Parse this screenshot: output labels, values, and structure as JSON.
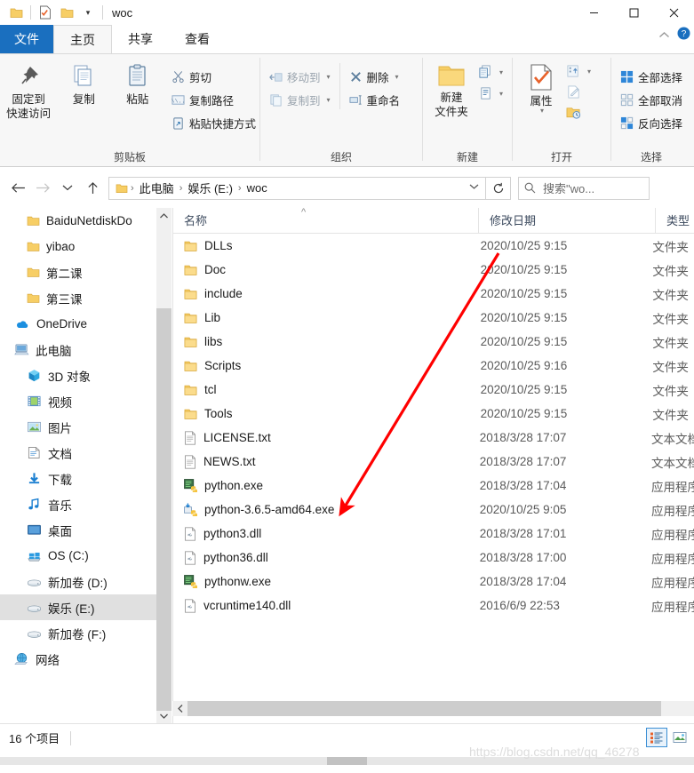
{
  "window": {
    "title": "woc",
    "quick_access": [
      "folder-icon",
      "properties-icon",
      "new-folder-icon"
    ],
    "qat_dropdown": "▾",
    "minimize": "—",
    "maximize": "▢",
    "close": "✕"
  },
  "tabs": [
    {
      "id": "file",
      "label": "文件"
    },
    {
      "id": "home",
      "label": "主页"
    },
    {
      "id": "share",
      "label": "共享"
    },
    {
      "id": "view",
      "label": "查看"
    }
  ],
  "ribbon": {
    "collapse_icon": "chevron-up-icon",
    "help_icon": "help-icon",
    "groups": [
      {
        "id": "clipboard",
        "label": "剪贴板",
        "big_buttons": [
          {
            "id": "pin-to-quick-access",
            "label": "固定到\n快速访问",
            "line1": "固定到",
            "line2": "快速访问",
            "icon": "pin-icon"
          },
          {
            "id": "copy",
            "label": "复制",
            "icon": "copy-icon"
          },
          {
            "id": "paste",
            "label": "粘贴",
            "icon": "paste-icon"
          }
        ],
        "small_buttons": [
          {
            "id": "cut",
            "label": "剪切",
            "icon": "scissors-icon",
            "dim": false
          },
          {
            "id": "copy-path",
            "label": "复制路径",
            "icon": "copy-path-icon",
            "dim": false
          },
          {
            "id": "paste-shortcut",
            "label": "粘贴快捷方式",
            "icon": "paste-shortcut-icon",
            "dim": false
          }
        ]
      },
      {
        "id": "organize",
        "label": "组织",
        "small_buttons": [
          {
            "id": "move-to",
            "label": "移动到",
            "icon": "move-to-icon",
            "caret": "▾",
            "dim": true
          },
          {
            "id": "copy-to",
            "label": "复制到",
            "icon": "copy-to-icon",
            "caret": "▾",
            "dim": true
          },
          {
            "id": "delete",
            "label": "删除",
            "icon": "delete-x-icon",
            "caret": "▾",
            "dim": false
          },
          {
            "id": "rename",
            "label": "重命名",
            "icon": "rename-icon",
            "dim": false
          }
        ]
      },
      {
        "id": "new",
        "label": "新建",
        "big_buttons": [
          {
            "id": "new-folder",
            "label": "新建\n文件夹",
            "line1": "新建",
            "line2": "文件夹",
            "icon": "new-folder-icon"
          }
        ],
        "stack_icons": [
          {
            "id": "new-item",
            "icon": "new-item-icon",
            "caret": "▾"
          },
          {
            "id": "easy-access",
            "icon": "easy-access-icon",
            "caret": "▾"
          }
        ]
      },
      {
        "id": "open",
        "label": "打开",
        "big_buttons": [
          {
            "id": "properties",
            "label": "属性",
            "line1": "属性",
            "line2": "",
            "icon": "properties-icon",
            "caret": "▾"
          }
        ],
        "stack_icons": [
          {
            "id": "open-with",
            "icon": "open-with-icon",
            "caret": "▾"
          },
          {
            "id": "edit",
            "icon": "edit-icon"
          },
          {
            "id": "history",
            "icon": "history-icon"
          }
        ]
      },
      {
        "id": "select",
        "label": "选择",
        "small_buttons": [
          {
            "id": "select-all",
            "label": "全部选择",
            "icon": "select-all-icon",
            "dim": false
          },
          {
            "id": "select-none",
            "label": "全部取消",
            "icon": "select-none-icon",
            "dim": false
          },
          {
            "id": "invert-selection",
            "label": "反向选择",
            "icon": "invert-selection-icon",
            "dim": false
          }
        ]
      }
    ]
  },
  "addressbar": {
    "back_icon": "arrow-left-icon",
    "forward_icon": "arrow-right-icon",
    "recent_icon": "chevron-down-icon",
    "up_icon": "arrow-up-icon",
    "folder_icon": "folder-icon",
    "breadcrumbs": [
      "此电脑",
      "娱乐 (E:)",
      "woc"
    ],
    "separator": "›",
    "dropdown": "⌄",
    "refresh_icon": "refresh-icon",
    "search_icon": "search-icon",
    "search_placeholder": "搜索\"wo..."
  },
  "nav_pane": {
    "items": [
      {
        "id": "baidunetdisk",
        "label": "BaiduNetdiskDo",
        "icon": "folder-icon",
        "indent": 1,
        "selected": false
      },
      {
        "id": "yibao",
        "label": "yibao",
        "icon": "folder-icon",
        "indent": 1,
        "selected": false
      },
      {
        "id": "lesson2",
        "label": "第二课",
        "icon": "folder-icon",
        "indent": 1,
        "selected": false
      },
      {
        "id": "lesson3",
        "label": "第三课",
        "icon": "folder-icon",
        "indent": 1,
        "selected": false
      },
      {
        "id": "onedrive",
        "label": "OneDrive",
        "icon": "onedrive-icon",
        "indent": 0,
        "selected": false
      },
      {
        "id": "this-pc",
        "label": "此电脑",
        "icon": "this-pc-icon",
        "indent": 0,
        "selected": false
      },
      {
        "id": "3d-objects",
        "label": "3D 对象",
        "icon": "3d-objects-icon",
        "indent": 1,
        "selected": false
      },
      {
        "id": "videos",
        "label": "视频",
        "icon": "videos-icon",
        "indent": 1,
        "selected": false
      },
      {
        "id": "pictures",
        "label": "图片",
        "icon": "pictures-icon",
        "indent": 1,
        "selected": false
      },
      {
        "id": "documents",
        "label": "文档",
        "icon": "documents-icon",
        "indent": 1,
        "selected": false
      },
      {
        "id": "downloads",
        "label": "下载",
        "icon": "downloads-icon",
        "indent": 1,
        "selected": false
      },
      {
        "id": "music",
        "label": "音乐",
        "icon": "music-icon",
        "indent": 1,
        "selected": false
      },
      {
        "id": "desktop",
        "label": "桌面",
        "icon": "desktop-icon",
        "indent": 1,
        "selected": false
      },
      {
        "id": "os-c",
        "label": "OS (C:)",
        "icon": "windows-drive-icon",
        "indent": 1,
        "selected": false
      },
      {
        "id": "drive-d",
        "label": "新加卷 (D:)",
        "icon": "drive-icon",
        "indent": 1,
        "selected": false
      },
      {
        "id": "drive-e",
        "label": "娱乐 (E:)",
        "icon": "drive-icon",
        "indent": 1,
        "selected": true
      },
      {
        "id": "drive-f",
        "label": "新加卷 (F:)",
        "icon": "drive-icon",
        "indent": 1,
        "selected": false
      },
      {
        "id": "network",
        "label": "网络",
        "icon": "network-icon",
        "indent": 0,
        "selected": false
      }
    ]
  },
  "file_list": {
    "columns": [
      {
        "id": "name",
        "label": "名称"
      },
      {
        "id": "date",
        "label": "修改日期"
      },
      {
        "id": "type",
        "label": "类型"
      }
    ],
    "sort_indicator": "^",
    "rows": [
      {
        "name": "DLLs",
        "date": "2020/10/25 9:15",
        "type": "文件夹",
        "icon": "folder-icon"
      },
      {
        "name": "Doc",
        "date": "2020/10/25 9:15",
        "type": "文件夹",
        "icon": "folder-icon"
      },
      {
        "name": "include",
        "date": "2020/10/25 9:15",
        "type": "文件夹",
        "icon": "folder-icon"
      },
      {
        "name": "Lib",
        "date": "2020/10/25 9:15",
        "type": "文件夹",
        "icon": "folder-icon"
      },
      {
        "name": "libs",
        "date": "2020/10/25 9:15",
        "type": "文件夹",
        "icon": "folder-icon"
      },
      {
        "name": "Scripts",
        "date": "2020/10/25 9:16",
        "type": "文件夹",
        "icon": "folder-icon"
      },
      {
        "name": "tcl",
        "date": "2020/10/25 9:15",
        "type": "文件夹",
        "icon": "folder-icon"
      },
      {
        "name": "Tools",
        "date": "2020/10/25 9:15",
        "type": "文件夹",
        "icon": "folder-icon"
      },
      {
        "name": "LICENSE.txt",
        "date": "2018/3/28 17:07",
        "type": "文本文档",
        "icon": "text-file-icon"
      },
      {
        "name": "NEWS.txt",
        "date": "2018/3/28 17:07",
        "type": "文本文档",
        "icon": "text-file-icon"
      },
      {
        "name": "python.exe",
        "date": "2018/3/28 17:04",
        "type": "应用程序",
        "icon": "python-exe-icon"
      },
      {
        "name": "python-3.6.5-amd64.exe",
        "date": "2020/10/25 9:05",
        "type": "应用程序",
        "icon": "python-installer-icon"
      },
      {
        "name": "python3.dll",
        "date": "2018/3/28 17:01",
        "type": "应用程序扩展",
        "icon": "dll-icon"
      },
      {
        "name": "python36.dll",
        "date": "2018/3/28 17:00",
        "type": "应用程序扩展",
        "icon": "dll-icon"
      },
      {
        "name": "pythonw.exe",
        "date": "2018/3/28 17:04",
        "type": "应用程序",
        "icon": "python-exe-icon"
      },
      {
        "name": "vcruntime140.dll",
        "date": "2016/6/9 22:53",
        "type": "应用程序扩展",
        "icon": "dll-icon"
      }
    ]
  },
  "statusbar": {
    "item_count": "16 个项目",
    "view_details_icon": "details-view-icon",
    "view_thumbnails_icon": "thumbnail-view-icon"
  },
  "annotation": {
    "arrow_color": "#FF0000",
    "points_at": "python-3.6.5-amd64.exe"
  },
  "watermark": {
    "text": "https://blog.csdn.net/qq_46278"
  },
  "colors": {
    "accent_blue": "#1A6FBF",
    "ribbon_bg": "#f7f7f7",
    "selection_gray": "#e0e0e0",
    "folder_yellow": "#F7CE65",
    "arrow_red": "#FF0000"
  }
}
